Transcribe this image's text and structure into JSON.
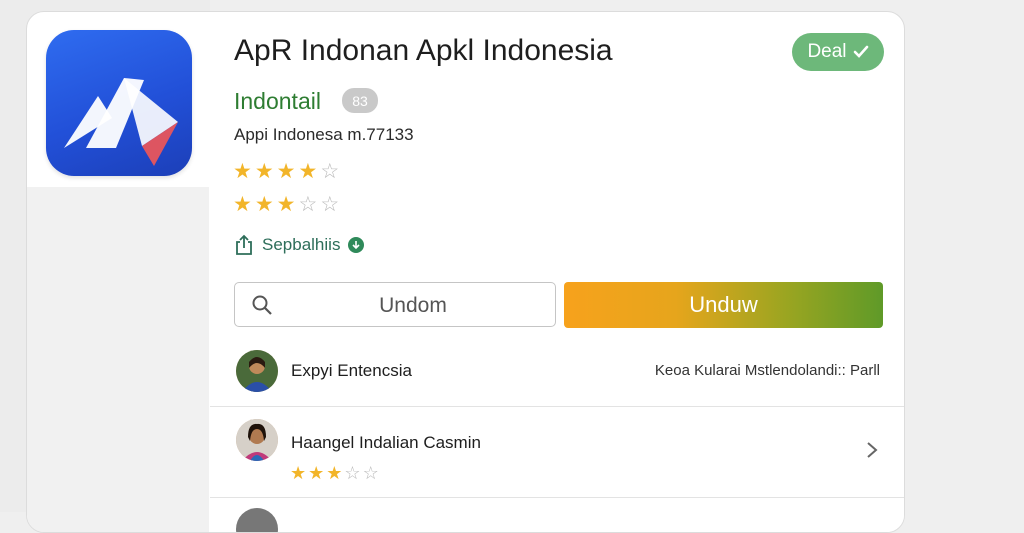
{
  "header": {
    "title": "ApR Indonan Apkl Indonesia",
    "deal_badge": "Deal",
    "developer": "Indontail",
    "developer_chip": "83",
    "subtitle": "Appi Indonesa m.77133",
    "rating_primary": 4.5,
    "rating_secondary": 2.5,
    "share_label": "Sepbalhiis"
  },
  "actions": {
    "search_value": "Undom",
    "download_label": "Unduw"
  },
  "list": [
    {
      "name": "Expyi Entencsia",
      "meta": "Keoa Kularai Mstlendolandi:: Parll"
    },
    {
      "name": "Haangel Indalian Casmin",
      "rating": 3.5
    },
    {
      "name": ""
    }
  ],
  "colors": {
    "deal_badge": "#6db87a",
    "developer": "#2e7d32",
    "star": "#f2b52a",
    "download_start": "#f7a21c",
    "download_end": "#5f9a28"
  },
  "icons": [
    "app-logo-icon",
    "check-icon",
    "star-icon",
    "share-icon",
    "verified-icon",
    "search-icon",
    "chevron-right-icon"
  ]
}
